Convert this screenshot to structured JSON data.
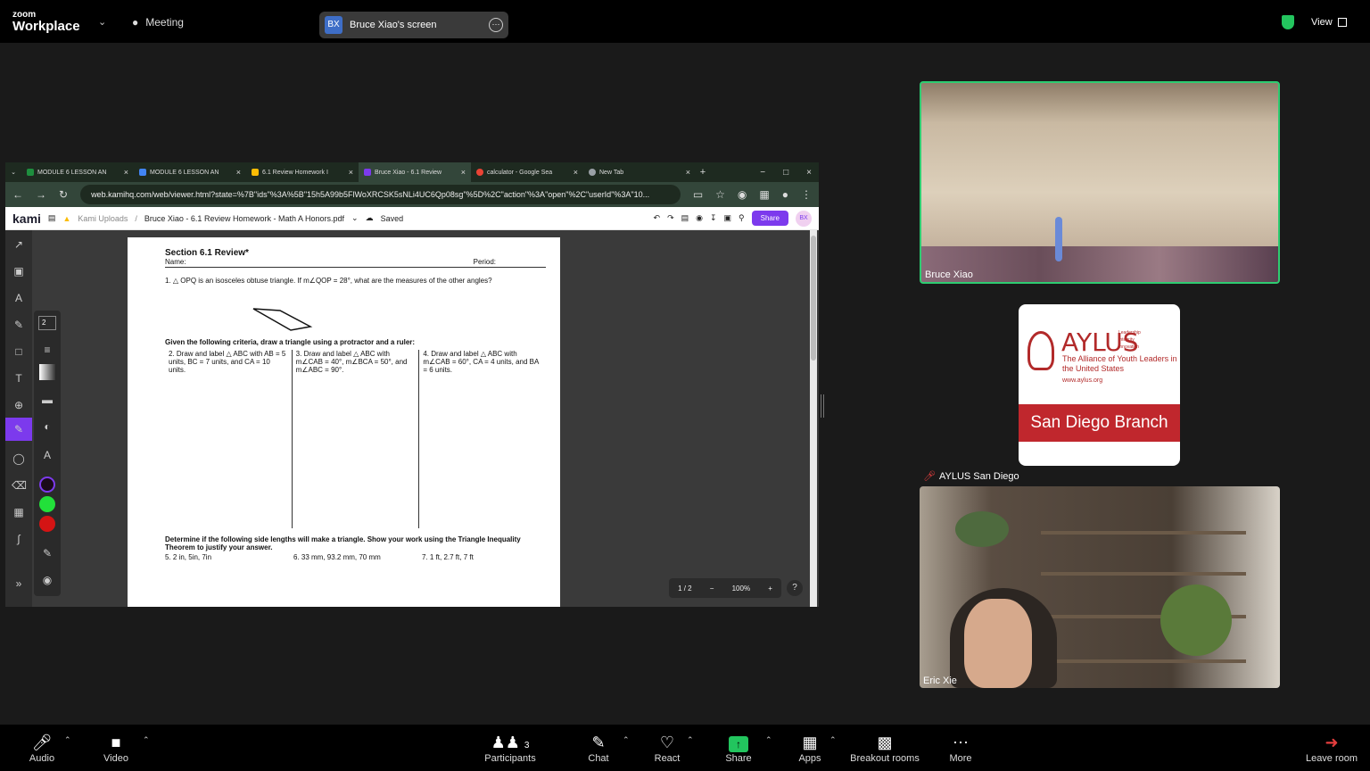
{
  "top": {
    "logo_line1": "zoom",
    "logo_line2": "Workplace",
    "meeting_label": "Meeting",
    "screen_avatar": "BX",
    "screen_label": "Bruce Xiao's screen",
    "view_label": "View"
  },
  "browser": {
    "tabs": [
      {
        "label": "MODULE 6 LESSON AN",
        "favicon_color": "#1e8e3e"
      },
      {
        "label": "MODULE 6 LESSON AN",
        "favicon_color": "#4285f4"
      },
      {
        "label": "6.1 Review Homework I",
        "favicon_color": "#fbbc04"
      },
      {
        "label": "Bruce Xiao - 6.1 Review",
        "favicon_color": "#7c3aed"
      },
      {
        "label": "calculator - Google Sea",
        "favicon_color": "#ea4335"
      },
      {
        "label": "New Tab",
        "favicon_color": "#9aa0a6"
      }
    ],
    "url": "web.kamihq.com/web/viewer.html?state=%7B\"ids\"%3A%5B\"15h5A99b5FlWoXRCSK5sNLi4UC6Qp08sg\"%5D%2C\"action\"%3A\"open\"%2C\"userId\"%3A\"10...",
    "kami": {
      "logo": "kami",
      "crumb_folder": "Kami Uploads",
      "crumb_file": "Bruce Xiao - 6.1 Review Homework - Math A Honors.pdf",
      "saved": "Saved",
      "share": "Share",
      "avatar": "BX",
      "stroke_size": "2"
    },
    "page": {
      "title": "Section 6.1 Review*",
      "name_label": "Name:",
      "period_label": "Period:",
      "q1": "1.   △ OPQ is an isosceles obtuse triangle.  If m∠QOP = 28°, what are the measures of the other angles?",
      "criteria_heading": "Given the following criteria, draw a triangle using a protractor and a ruler:",
      "q2": "2.   Draw and label △ ABC with AB = 5 units, BC = 7 units, and CA = 10 units.",
      "q3": "3.   Draw and label △ ABC with m∠CAB = 40°, m∠BCA = 50°, and m∠ABC = 90°.",
      "q4": "4.   Draw and label △ ABC with m∠CAB = 60°, CA = 4 units, and BA = 6 units.",
      "inequality_heading": "Determine if the following side lengths will make a triangle. Show your work using the Triangle Inequality Theorem to justify your answer.",
      "q5": "5.   2 in, 5in, 7in",
      "q6": "6.   33 mm, 93.2 mm, 70 mm",
      "q7": "7.   1 ft, 2.7 ft, 7 ft"
    },
    "zoom": {
      "page": "1 / 2",
      "level": "100%"
    }
  },
  "participants": {
    "tile1_name": "Bruce Xiao",
    "tile2_name": "AYLUS San Diego",
    "tile3_name": "Eric Xie",
    "aylus": {
      "word": "AYLUS",
      "values": "Leadership\nIntegrity\nInnovation",
      "sub": "The Alliance of Youth Leaders in the United States",
      "site": "www.aylus.org",
      "branch": "San Diego Branch"
    }
  },
  "toolbar": {
    "audio": "Audio",
    "video": "Video",
    "participants": "Participants",
    "participant_count": "3",
    "chat": "Chat",
    "react": "React",
    "share": "Share",
    "apps": "Apps",
    "breakout": "Breakout rooms",
    "more": "More",
    "leave": "Leave room"
  },
  "colors": {
    "accent": "#7c3aed",
    "active_speaker": "#2ecc71",
    "share_green": "#22c55e"
  }
}
